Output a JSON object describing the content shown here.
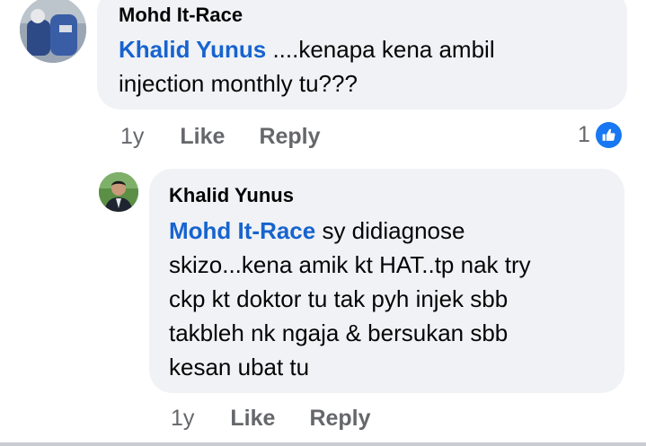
{
  "comment1": {
    "author": "Mohd It-Race",
    "mention": "Khalid Yunus",
    "text_line1": " ....kenapa kena ambil",
    "text_line2": "injection monthly tu???",
    "time": "1y",
    "like_label": "Like",
    "reply_label": "Reply",
    "reaction_count": "1",
    "reaction_icon": "thumbs-up-icon",
    "reaction_color": "#1877f2"
  },
  "comment2": {
    "author": "Khalid Yunus",
    "mention": "Mohd It-Race",
    "text_line1": " sy didiagnose",
    "text_line2": "skizo...kena amik kt HAT..tp nak try",
    "text_line3": "ckp kt doktor tu tak pyh injek sbb",
    "text_line4": "takbleh nk ngaja & bersukan sbb",
    "text_line5": "kesan ubat tu",
    "time": "1y",
    "like_label": "Like",
    "reply_label": "Reply"
  },
  "colors": {
    "bubble": "#f0f2f5",
    "mention": "#1763cf",
    "meta": "#65676b"
  }
}
